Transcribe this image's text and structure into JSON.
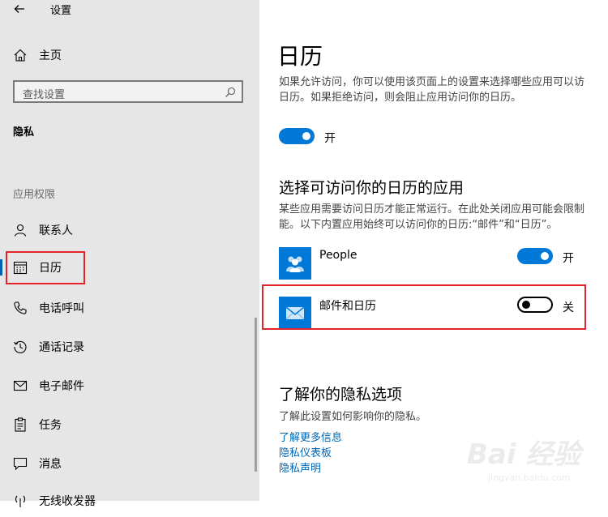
{
  "window": {
    "title": "设置"
  },
  "sidebar": {
    "home_label": "主页",
    "search": {
      "placeholder": "查找设置"
    },
    "section_title": "隐私",
    "group_title": "应用权限",
    "items": [
      {
        "label": "联系人",
        "icon": "contacts-icon"
      },
      {
        "label": "日历",
        "icon": "calendar-icon",
        "selected": true
      },
      {
        "label": "电话呼叫",
        "icon": "phone-icon"
      },
      {
        "label": "通话记录",
        "icon": "history-icon"
      },
      {
        "label": "电子邮件",
        "icon": "mail-icon"
      },
      {
        "label": "任务",
        "icon": "tasks-icon"
      },
      {
        "label": "消息",
        "icon": "message-icon"
      },
      {
        "label": "无线收发器",
        "icon": "radio-icon"
      }
    ]
  },
  "main": {
    "title": "日历",
    "description_line1": "如果允许访问，你可以使用该页面上的设置来选择哪些应用可以访",
    "description_line2": "日历。如果拒绝访问，则会阻止应用访问你的日历。",
    "main_toggle": {
      "state": "on",
      "label": "开"
    },
    "apps_heading": "选择可访问你的日历的应用",
    "apps_desc_line1": "某些应用需要访问日历才能正常运行。在此处关闭应用可能会限制",
    "apps_desc_line2": "能。以下内置应用始终可以访问你的日历:“邮件”和“日历”。",
    "apps": [
      {
        "name": "People",
        "toggle": "on",
        "toggle_label": "开"
      },
      {
        "name": "邮件和日历",
        "toggle": "off",
        "toggle_label": "关"
      }
    ],
    "privacy_heading": "了解你的隐私选项",
    "privacy_desc": "了解此设置如何影响你的隐私。",
    "links": [
      "了解更多信息",
      "隐私仪表板",
      "隐私声明"
    ]
  },
  "watermark": {
    "logo": "Bai 经验",
    "url": "jingyan.baidu.com"
  },
  "colors": {
    "accent": "#0078d7",
    "highlight": "#e2232a",
    "link": "#0066b4",
    "sidebar_bg": "#e6e6e6"
  }
}
